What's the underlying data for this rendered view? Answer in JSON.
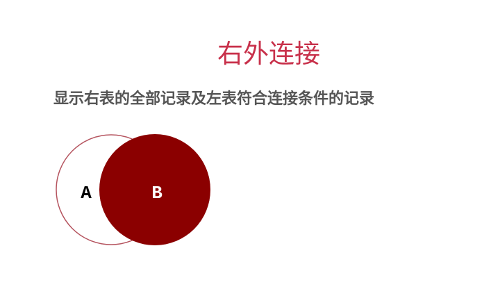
{
  "title": "右外连接",
  "subtitle": "显示右表的全部记录及左表符合连接条件的记录",
  "diagram": {
    "left_set": {
      "label": "A",
      "fill": "#ffffff",
      "stroke": "#b5545f",
      "highlighted": false
    },
    "right_set": {
      "label": "B",
      "fill": "#8b0000",
      "label_color": "#ffffff",
      "highlighted": true
    }
  }
}
